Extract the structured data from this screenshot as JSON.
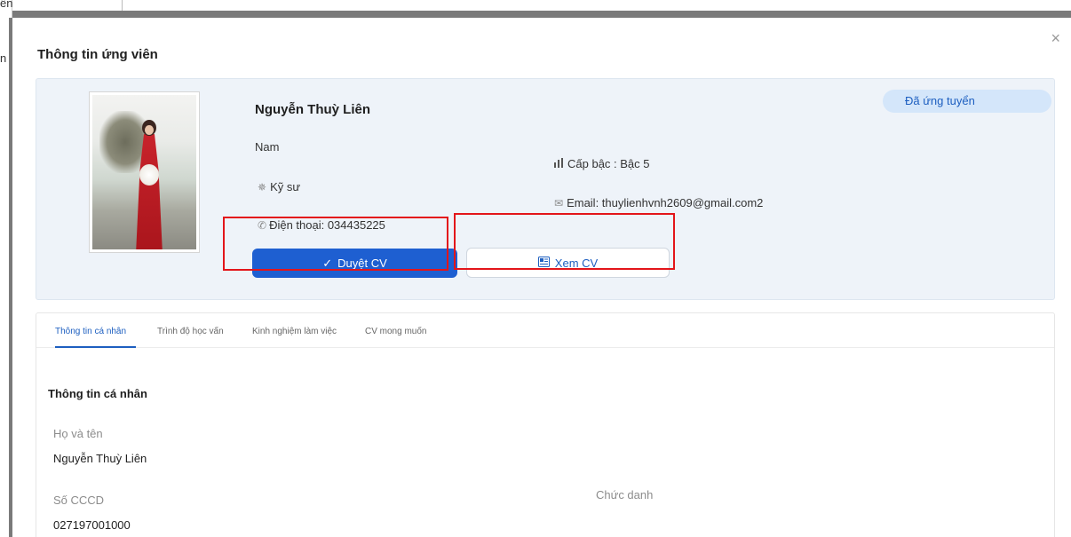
{
  "background": {
    "fragment_top": "ên",
    "fragment_mid": "n"
  },
  "modal": {
    "title": "Thông tin ứng viên",
    "close_glyph": "×"
  },
  "candidate": {
    "name": "Nguyễn Thuỳ Liên",
    "gender": "Nam",
    "job": "Kỹ sư",
    "phone": "Điện thoại: 034435225",
    "level": "Cấp bậc : Bậc 5",
    "email": "Email: thuylienhvnh2609@gmail.com2",
    "status": "Đã ứng tuyển"
  },
  "actions": {
    "approve_label": "Duyệt CV",
    "view_label": "Xem CV"
  },
  "tabs": [
    {
      "label": "Thông tin cá nhân",
      "active": true
    },
    {
      "label": "Trình độ học vấn",
      "active": false
    },
    {
      "label": "Kinh nghiệm làm việc",
      "active": false
    },
    {
      "label": "CV mong muốn",
      "active": false
    }
  ],
  "personal": {
    "section_title": "Thông tin cá nhân",
    "fullname_label": "Họ và tên",
    "fullname_value": "Nguyễn Thuỳ Liên",
    "id_label": "Số CCCD",
    "id_value": "027197001000",
    "position_label": "Chức danh"
  },
  "icons": {
    "job": "gear-icon",
    "phone": "phone-icon",
    "level": "bar-chart-icon",
    "email": "envelope-icon",
    "approve": "check-icon",
    "view": "document-icon",
    "close": "close-icon"
  },
  "colors": {
    "primary": "#1e5fd1",
    "status_bg": "#d4e6fa",
    "card_bg": "#eef3f9",
    "highlight": "#e3151a"
  }
}
